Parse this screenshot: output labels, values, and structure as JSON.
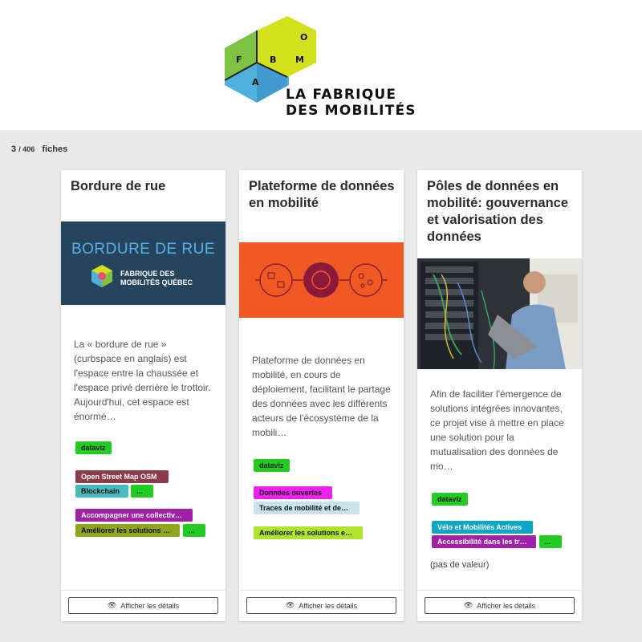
{
  "brand": {
    "line1": "LA FABRIQUE",
    "line2": "DES MOBILITÉS",
    "cube_letters": [
      "O",
      "F",
      "B",
      "M",
      "A"
    ]
  },
  "count": {
    "current": "3",
    "total": "/ 406",
    "label": "fiches"
  },
  "cards": [
    {
      "title": "Bordure de rue",
      "image": {
        "title": "BORDURE DE RUE",
        "subtitle_line1": "FABRIQUE DES",
        "subtitle_line2": "MOBILITÉS QUÉBEC"
      },
      "description": "La « bordure de rue » (curbspace en anglais) est l'espace entre la chaussée et l'espace privé derrière le trottoir. Aujourd'hui, cet espace est énormé…",
      "tags": [
        [
          "dataviz"
        ],
        [
          "Open Street Map OSM",
          "Blockchain",
          "..."
        ],
        [
          "Accompagner une collectiv…",
          "Améliorer les solutions …",
          "..."
        ]
      ],
      "button": "Afficher les détails"
    },
    {
      "title": "Plateforme de données en mobilité",
      "description": "Plateforme de données en mobilité, en cours de déploiement, facilitant le partage des données avec les différents acteurs de l'écosystème de la mobili…",
      "tags": [
        [
          "dataviz"
        ],
        [
          "Données ouvertes",
          "Traces de mobilité et de…"
        ],
        [
          "Améliorer les solutions e…"
        ]
      ],
      "button": "Afficher les détails"
    },
    {
      "title": "Pôles de données en mobilité: gouvernance et valorisation des données",
      "description": "Afin de faciliter l'émergence de solutions intégrées innovantes, ce projet vise à mettre en place une solution pour la mutualisation des données de mo…",
      "tags": [
        [
          "dataviz"
        ],
        [
          "Vélo et Mobilités Actives",
          "Accessibilité dans les tr…",
          "..."
        ]
      ],
      "no_value": "(pas de valeur)",
      "button": "Afficher les détails"
    }
  ],
  "colors": {
    "background": "#e9e9e9",
    "tag_green": "#22cc22",
    "tag_maroon": "#8c3b4a",
    "tag_teal": "#4bbabf",
    "tag_purple": "#a020a6",
    "tag_olive": "#8ea61c",
    "tag_magenta": "#ee22ee",
    "tag_light_blue": "#c6e3ee",
    "tag_lime": "#aee42a",
    "tag_blue": "#0aa6c8",
    "logo_yellow": "#d4e01c",
    "logo_blue": "#4fb0df",
    "logo_green": "#7dc243",
    "image_orange": "#f05a22",
    "image_navy": "#27445e"
  }
}
